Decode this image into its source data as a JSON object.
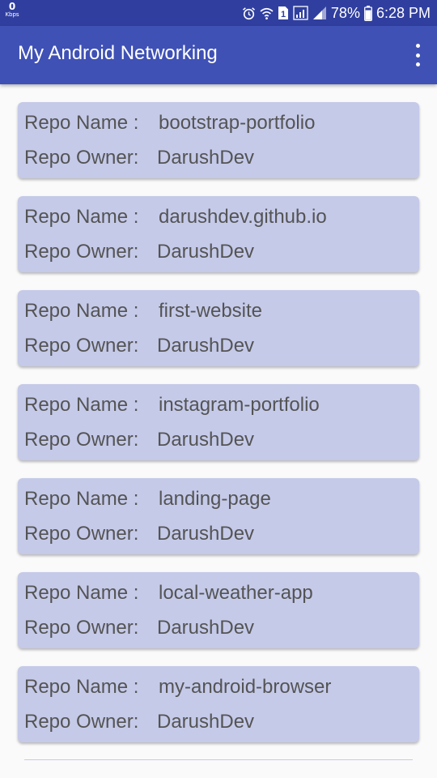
{
  "status_bar": {
    "speed_value": "0",
    "speed_unit": "Kbps",
    "battery": "78%",
    "time": "6:28 PM",
    "icons": [
      "alarm-icon",
      "wifi-icon",
      "sim-icon",
      "signal-icon",
      "signal-icon-2",
      "battery-icon"
    ]
  },
  "app_bar": {
    "title": "My Android Networking",
    "overflow_icon": "more-vert-icon"
  },
  "labels": {
    "repo_name": "Repo Name :",
    "repo_owner": "Repo Owner:"
  },
  "repos": [
    {
      "name": "bootstrap-portfolio",
      "owner": "DarushDev"
    },
    {
      "name": "darushdev.github.io",
      "owner": "DarushDev"
    },
    {
      "name": "first-website",
      "owner": "DarushDev"
    },
    {
      "name": "instagram-portfolio",
      "owner": "DarushDev"
    },
    {
      "name": "landing-page",
      "owner": "DarushDev"
    },
    {
      "name": "local-weather-app",
      "owner": "DarushDev"
    },
    {
      "name": "my-android-browser",
      "owner": "DarushDev"
    }
  ],
  "colors": {
    "status_bar": "#303f9f",
    "app_bar": "#3f51b5",
    "card_background": "#c5cae9",
    "card_text": "#545454"
  }
}
